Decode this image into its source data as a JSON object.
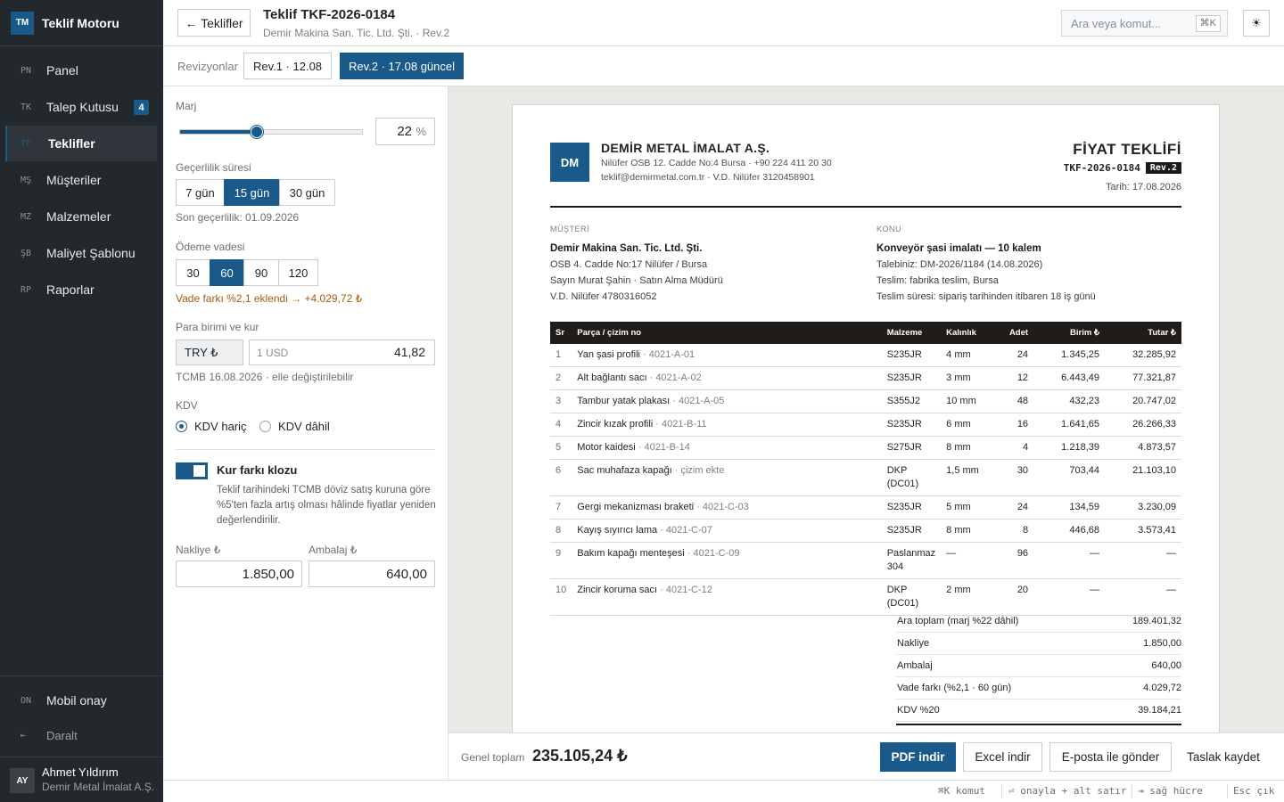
{
  "app": {
    "logo": "TM",
    "name": "Teklif Motoru"
  },
  "sidebar": {
    "items": [
      {
        "code": "PN",
        "label": "Panel"
      },
      {
        "code": "TK",
        "label": "Talep Kutusu",
        "badge": "4"
      },
      {
        "code": "TF",
        "label": "Teklifler"
      },
      {
        "code": "MŞ",
        "label": "Müşteriler"
      },
      {
        "code": "MZ",
        "label": "Malzemeler"
      },
      {
        "code": "ŞB",
        "label": "Maliyet Şablonu"
      },
      {
        "code": "RP",
        "label": "Raporlar"
      }
    ],
    "active_index": 2,
    "mobile": {
      "code": "ON",
      "label": "Mobil onay"
    },
    "collapse": {
      "icon": "⇤",
      "label": "Daralt"
    },
    "user": {
      "initials": "AY",
      "name": "Ahmet Yıldırım",
      "company": "Demir Metal İmalat A.Ş."
    }
  },
  "header": {
    "back_label": "← Teklifler",
    "title": "Teklif TKF-2026-0184",
    "subtitle": "Demir Makina San. Tic. Ltd. Şti. · Rev.2",
    "search_placeholder": "Ara veya komut...",
    "search_shortcut": "⌘K",
    "theme_icon": "☀"
  },
  "revisions": {
    "label": "Revizyonlar",
    "items": [
      "Rev.1 · 12.08",
      "Rev.2 · 17.08 güncel"
    ],
    "active_index": 1
  },
  "settings": {
    "margin": {
      "label": "Marj",
      "value": "22",
      "unit": "%",
      "slider_fraction": 0.42
    },
    "validity": {
      "label": "Geçerlilik süresi",
      "options": [
        "7 gün",
        "15 gün",
        "30 gün"
      ],
      "selected": 1,
      "note": "Son geçerlilik: 01.09.2026"
    },
    "payment": {
      "label": "Ödeme vadesi",
      "options": [
        "30",
        "60",
        "90",
        "120"
      ],
      "selected": 1,
      "note": "Vade farkı %2,1 eklendi → +4.029,72 ₺"
    },
    "currency": {
      "label": "Para birimi ve kur",
      "currency": "TRY ₺",
      "rate_label": "1 USD",
      "rate_value": "41,82",
      "note": "TCMB 16.08.2026 · elle değiştirilebilir"
    },
    "vat": {
      "label": "KDV",
      "options": [
        "KDV hariç",
        "KDV dâhil"
      ],
      "selected": 0
    },
    "clause": {
      "title": "Kur farkı klozu",
      "enabled": true,
      "description": "Teklif tarihindeki TCMB döviz satış kuruna göre %5'ten fazla artış olması hâlinde fiyatlar yeniden değerlendirilir."
    },
    "shipping": {
      "label": "Nakliye ₺",
      "value": "1.850,00"
    },
    "packaging": {
      "label": "Ambalaj ₺",
      "value": "640,00"
    }
  },
  "document": {
    "logo": "DM",
    "company": {
      "name": "DEMİR METAL İMALAT A.Ş.",
      "address": "Nilüfer OSB 12. Cadde No:4 Bursa · +90 224 411 20 30",
      "contact": "teklif@demirmetal.com.tr · V.D. Nilüfer 3120458901"
    },
    "type": "FİYAT TEKLİFİ",
    "number": "TKF-2026-0184",
    "revision": "Rev.2",
    "date": "Tarih: 17.08.2026",
    "customer": {
      "heading": "MÜŞTERİ",
      "name": "Demir Makina San. Tic. Ltd. Şti.",
      "address": "OSB 4. Cadde No:17 Nilüfer / Bursa",
      "contact": "Sayın Murat Şahin · Satın Alma Müdürü",
      "tax": "V.D. Nilüfer 4780316052"
    },
    "subject": {
      "heading": "KONU",
      "title": "Konveyör şasi imalatı — 10 kalem",
      "request": "Talebiniz: DM-2026/1184 (14.08.2026)",
      "delivery": "Teslim: fabrika teslim, Bursa",
      "lead_time": "Teslim süresi: sipariş tarihinden itibaren 18 iş günü"
    },
    "columns": [
      "Sr",
      "Parça / çizim no",
      "Malzeme",
      "Kalınlık",
      "Adet",
      "Birim ₺",
      "Tutar ₺"
    ],
    "rows": [
      {
        "sr": "1",
        "part": "Yan şasi profili",
        "code": "4021-A-01",
        "material": "S235JR",
        "thickness": "4 mm",
        "qty": "24",
        "unit": "1.345,25",
        "total": "32.285,92"
      },
      {
        "sr": "2",
        "part": "Alt bağlantı sacı",
        "code": "4021-A-02",
        "material": "S235JR",
        "thickness": "3 mm",
        "qty": "12",
        "unit": "6.443,49",
        "total": "77.321,87"
      },
      {
        "sr": "3",
        "part": "Tambur yatak plakası",
        "code": "4021-A-05",
        "material": "S355J2",
        "thickness": "10 mm",
        "qty": "48",
        "unit": "432,23",
        "total": "20.747,02"
      },
      {
        "sr": "4",
        "part": "Zincir kızak profili",
        "code": "4021-B-11",
        "material": "S235JR",
        "thickness": "6 mm",
        "qty": "16",
        "unit": "1.641,65",
        "total": "26.266,33"
      },
      {
        "sr": "5",
        "part": "Motor kaidesi",
        "code": "4021-B-14",
        "material": "S275JR",
        "thickness": "8 mm",
        "qty": "4",
        "unit": "1.218,39",
        "total": "4.873,57"
      },
      {
        "sr": "6",
        "part": "Sac muhafaza kapağı",
        "code": "çizim ekte",
        "material": "DKP (DC01)",
        "thickness": "1,5 mm",
        "qty": "30",
        "unit": "703,44",
        "total": "21.103,10"
      },
      {
        "sr": "7",
        "part": "Gergi mekanizması braketi",
        "code": "4021-C-03",
        "material": "S235JR",
        "thickness": "5 mm",
        "qty": "24",
        "unit": "134,59",
        "total": "3.230,09"
      },
      {
        "sr": "8",
        "part": "Kayış sıyırıcı lama",
        "code": "4021-C-07",
        "material": "S235JR",
        "thickness": "8 mm",
        "qty": "8",
        "unit": "446,68",
        "total": "3.573,41"
      },
      {
        "sr": "9",
        "part": "Bakım kapağı menteşesi",
        "code": "4021-C-09",
        "material": "Paslanmaz 304",
        "thickness": "—",
        "qty": "96",
        "unit": "—",
        "total": "—"
      },
      {
        "sr": "10",
        "part": "Zincir koruma sacı",
        "code": "4021-C-12",
        "material": "DKP (DC01)",
        "thickness": "2 mm",
        "qty": "20",
        "unit": "—",
        "total": "—"
      }
    ],
    "totals": [
      {
        "label": "Ara toplam (marj %22 dâhil)",
        "value": "189.401,32"
      },
      {
        "label": "Nakliye",
        "value": "1.850,00"
      },
      {
        "label": "Ambalaj",
        "value": "640,00"
      },
      {
        "label": "Vade farkı (%2,1 · 60 gün)",
        "value": "4.029,72"
      },
      {
        "label": "KDV %20",
        "value": "39.184,21"
      }
    ]
  },
  "actions": {
    "grand_total_label": "Genel toplam",
    "grand_total": "235.105,24 ₺",
    "pdf": "PDF indir",
    "excel": "Excel indir",
    "email": "E-posta ile gönder",
    "draft": "Taslak kaydet"
  },
  "statusbar": [
    "⌘K komut",
    "⏎ onayla + alt satır",
    "⇥ sağ hücre",
    "Esc çık"
  ],
  "colors": {
    "accent": "#1a5a8a",
    "sidebar": "#23282d",
    "warning": "#a85a10",
    "table_header": "#1f1c1a"
  }
}
